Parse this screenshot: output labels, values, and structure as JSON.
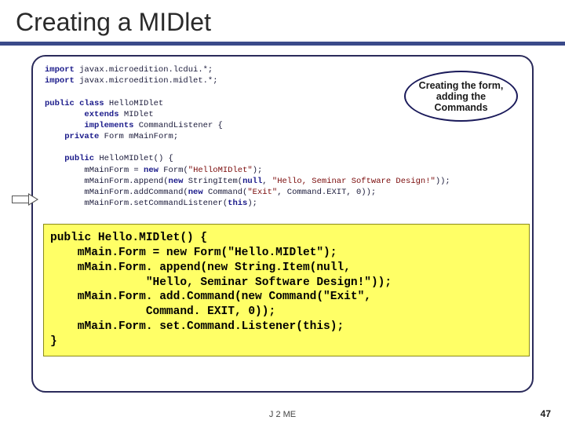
{
  "title": "Creating a MIDlet",
  "callout_text": "Creating the form, adding the Commands",
  "bg_code_lines": [
    {
      "indent": 0,
      "segs": [
        {
          "t": "import ",
          "c": "kw"
        },
        {
          "t": "javax.microedition.lcdui.*;"
        }
      ]
    },
    {
      "indent": 0,
      "segs": [
        {
          "t": "import ",
          "c": "kw"
        },
        {
          "t": "javax.microedition.midlet.*;"
        }
      ]
    },
    {
      "indent": 0,
      "segs": [
        {
          "t": ""
        }
      ]
    },
    {
      "indent": 0,
      "segs": [
        {
          "t": "public class ",
          "c": "kw"
        },
        {
          "t": "HelloMIDlet"
        }
      ]
    },
    {
      "indent": 2,
      "segs": [
        {
          "t": "extends ",
          "c": "kw"
        },
        {
          "t": "MIDlet"
        }
      ]
    },
    {
      "indent": 2,
      "segs": [
        {
          "t": "implements ",
          "c": "kw"
        },
        {
          "t": "CommandListener {"
        }
      ]
    },
    {
      "indent": 1,
      "segs": [
        {
          "t": "private ",
          "c": "kw"
        },
        {
          "t": "Form mMainForm;"
        }
      ]
    },
    {
      "indent": 0,
      "segs": [
        {
          "t": ""
        }
      ]
    },
    {
      "indent": 1,
      "segs": [
        {
          "t": "public ",
          "c": "kw"
        },
        {
          "t": "HelloMIDlet() {"
        }
      ]
    },
    {
      "indent": 2,
      "segs": [
        {
          "t": "mMainForm = "
        },
        {
          "t": "new ",
          "c": "kw"
        },
        {
          "t": "Form("
        },
        {
          "t": "\"HelloMIDlet\"",
          "c": "str"
        },
        {
          "t": ");"
        }
      ]
    },
    {
      "indent": 2,
      "segs": [
        {
          "t": "mMainForm.append("
        },
        {
          "t": "new ",
          "c": "kw"
        },
        {
          "t": "StringItem("
        },
        {
          "t": "null",
          "c": "kw"
        },
        {
          "t": ", "
        },
        {
          "t": "\"Hello, Seminar Software Design!\"",
          "c": "str"
        },
        {
          "t": "));"
        }
      ]
    },
    {
      "indent": 2,
      "segs": [
        {
          "t": "mMainForm.addCommand("
        },
        {
          "t": "new ",
          "c": "kw"
        },
        {
          "t": "Command("
        },
        {
          "t": "\"Exit\"",
          "c": "str"
        },
        {
          "t": ", Command.EXIT, 0));"
        }
      ]
    },
    {
      "indent": 2,
      "segs": [
        {
          "t": "mMainForm.setCommandListener("
        },
        {
          "t": "this",
          "c": "kw"
        },
        {
          "t": ");"
        }
      ]
    }
  ],
  "highlight_code": "public Hello.MIDlet() {\n    mMain.Form = new Form(\"Hello.MIDlet\");\n    mMain.Form. append(new String.Item(null,\n              \"Hello, Seminar Software Design!\"));\n    mMain.Form. add.Command(new Command(\"Exit\",\n              Command. EXIT, 0));\n    mMain.Form. set.Command.Listener(this);\n}",
  "footer": "J 2 ME",
  "page_number": "47"
}
